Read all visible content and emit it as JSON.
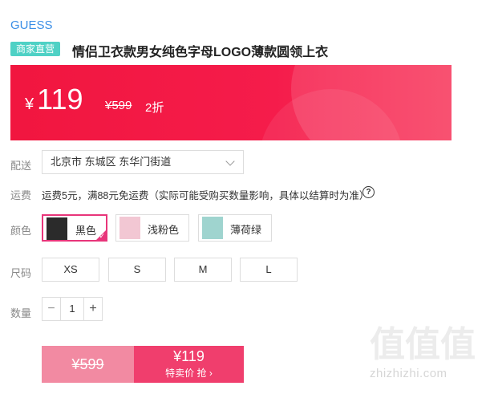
{
  "brand": "GUESS",
  "badge": "商家直营",
  "title": "情侣卫衣款男女纯色字母LOGO薄款圆领上衣",
  "price": {
    "symbol": "¥",
    "current": "119",
    "original": "¥599",
    "discount": "2折"
  },
  "delivery": {
    "label": "配送",
    "value": "北京市 东城区 东华门街道"
  },
  "shipping": {
    "label": "运费",
    "text": "运费5元，满88元免运费（实际可能受购买数量影响，具体以结算时为准）",
    "help": "?"
  },
  "color": {
    "label": "颜色",
    "options": [
      {
        "name": "黑色",
        "selected": true
      },
      {
        "name": "浅粉色",
        "selected": false
      },
      {
        "name": "薄荷绿",
        "selected": false
      }
    ],
    "thumb_colors": [
      "#2b2b2b",
      "#f2c7d3",
      "#9fd4cf"
    ]
  },
  "size": {
    "label": "尺码",
    "options": [
      "XS",
      "S",
      "M",
      "L"
    ]
  },
  "quantity": {
    "label": "数量",
    "value": "1",
    "minus": "−",
    "plus": "+"
  },
  "buy": {
    "original": "¥599",
    "price": "¥119",
    "action": "特卖价 抢 ›"
  },
  "watermark": {
    "glyphs": "值值值",
    "text": "zhizhizhi.com"
  },
  "colors": {
    "accent": "#f51c4b",
    "badge": "#4fd1c5",
    "brand": "#3a8ee6",
    "select_border": "#e8357a"
  }
}
